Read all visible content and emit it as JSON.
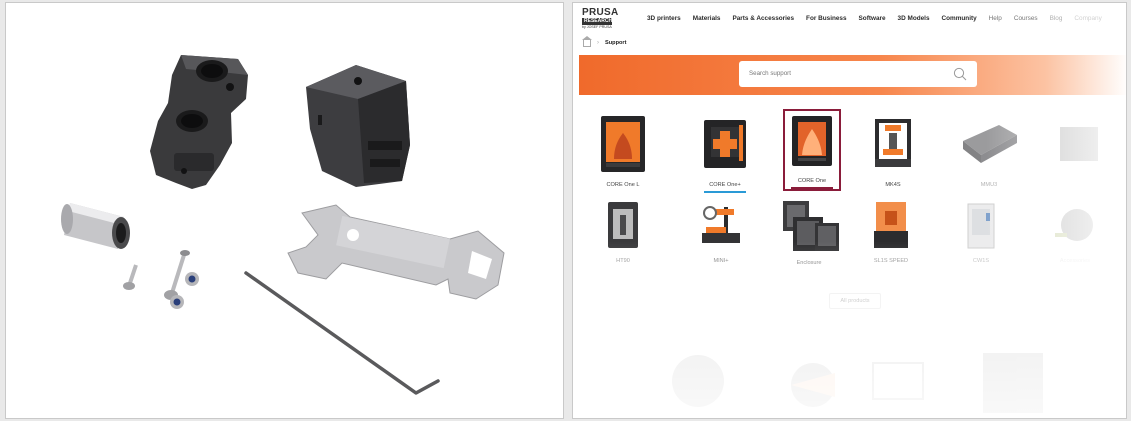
{
  "site": {
    "logo": {
      "line1": "PRUSA",
      "line2": "RESEARCH",
      "line3": "by JOSEF PRUSA"
    },
    "nav": [
      "3D printers",
      "Materials",
      "Parts & Accessories",
      "For Business",
      "Software",
      "3D Models",
      "Community",
      "Help",
      "Courses",
      "Blog",
      "Company"
    ],
    "breadcrumb": {
      "current": "Support"
    },
    "search": {
      "placeholder": "Search support"
    },
    "products_row1": [
      "CORE One L",
      "CORE One+",
      "CORE One",
      "MK4S",
      "MMU3",
      ""
    ],
    "products_row2": [
      "HT90",
      "MINI+",
      "Enclosure",
      "SL1S SPEED",
      "CW1S",
      "Accessories"
    ],
    "all_products_label": "All products",
    "selected_product": "CORE One"
  },
  "colors": {
    "accent": "#f06a2b",
    "highlight": "#8a1c3a",
    "underline_blue": "#2a9ad6",
    "underline_red": "#8a1c3a"
  },
  "kit_parts": [
    "printed-part-left",
    "printed-part-block",
    "linear-bearing",
    "screws",
    "nuts",
    "wrench",
    "allen-key"
  ]
}
